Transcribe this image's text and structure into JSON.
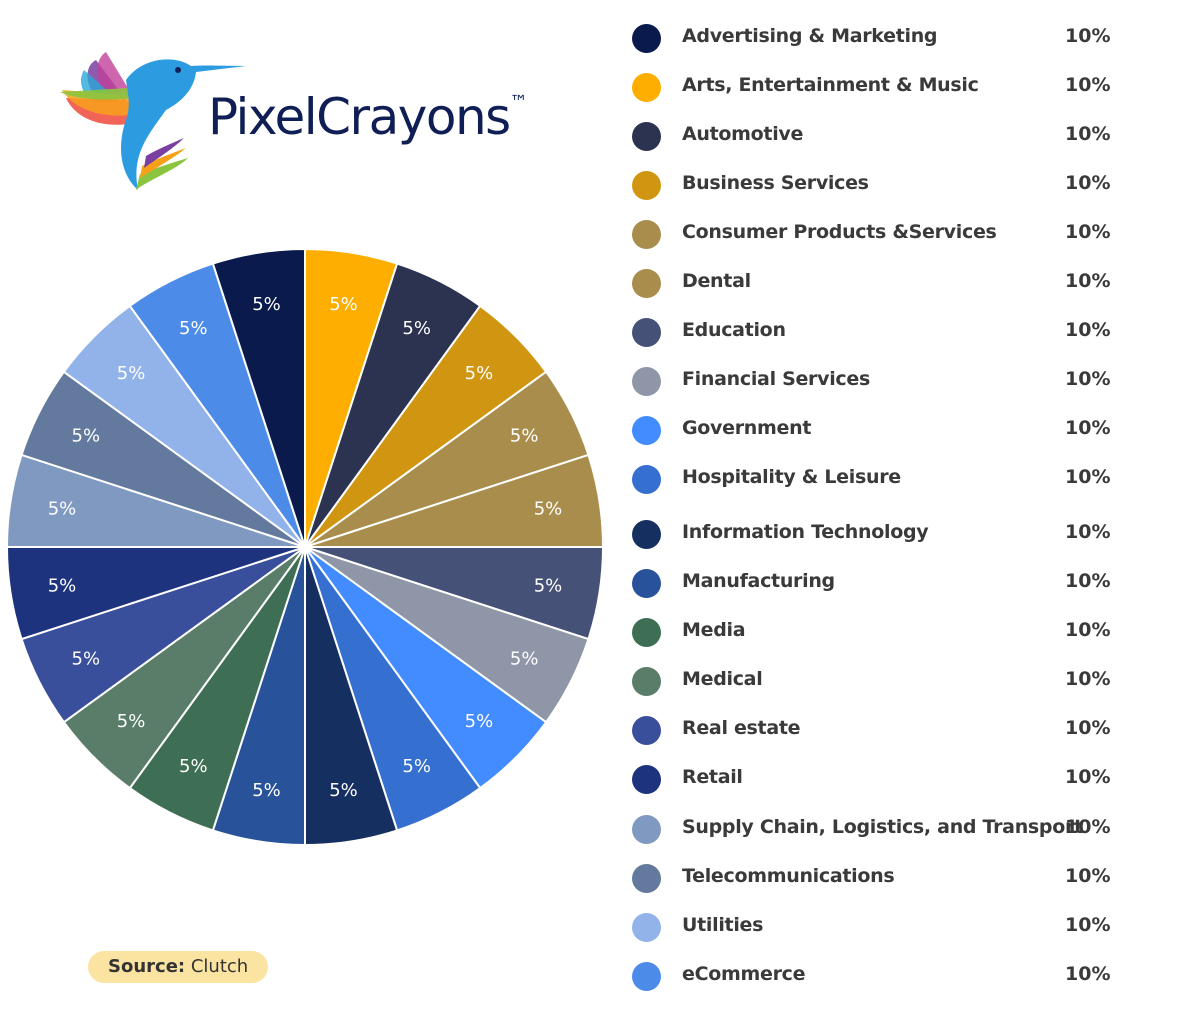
{
  "brand": {
    "name": "PixelCrayons",
    "tm": "™"
  },
  "source": {
    "label": "Source:",
    "value": "Clutch"
  },
  "chart_data": {
    "type": "pie",
    "start_angle_deg": -90,
    "categories": [
      "Advertising & Marketing",
      "Arts, Entertainment & Music",
      "Automotive",
      "Business Services",
      "Consumer Products &Services",
      "Dental",
      "Education",
      "Financial Services",
      "Government",
      "Hospitality & Leisure",
      "Information Technology",
      "Manufacturing",
      "Media",
      "Medical",
      "Real estate",
      "Retail",
      "Supply Chain, Logistics, and Transport",
      "Telecommunications",
      "Utilities",
      "eCommerce"
    ],
    "legend_values": [
      "10%",
      "10%",
      "10%",
      "10%",
      "10%",
      "10%",
      "10%",
      "10%",
      "10%",
      "10%",
      "10%",
      "10%",
      "10%",
      "10%",
      "10%",
      "10%",
      "10%",
      "10%",
      "10%",
      "10%"
    ],
    "slices": [
      {
        "category": "Arts, Entertainment & Music",
        "value": 5,
        "label": "5%",
        "color": "#FDAE00"
      },
      {
        "category": "Automotive",
        "value": 5,
        "label": "5%",
        "color": "#2C3350"
      },
      {
        "category": "Business Services",
        "value": 5,
        "label": "5%",
        "color": "#D09612"
      },
      {
        "category": "Consumer Products &Services",
        "value": 5,
        "label": "5%",
        "color": "#A98D4C"
      },
      {
        "category": "Dental",
        "value": 5,
        "label": "5%",
        "color": "#A98D4C"
      },
      {
        "category": "Education",
        "value": 5,
        "label": "5%",
        "color": "#465177"
      },
      {
        "category": "Financial Services",
        "value": 5,
        "label": "5%",
        "color": "#8F96A8"
      },
      {
        "category": "Government",
        "value": 5,
        "label": "5%",
        "color": "#428CFF"
      },
      {
        "category": "Hospitality & Leisure",
        "value": 5,
        "label": "5%",
        "color": "#3570D0"
      },
      {
        "category": "Information Technology",
        "value": 5,
        "label": "5%",
        "color": "#152F60"
      },
      {
        "category": "Manufacturing",
        "value": 5,
        "label": "5%",
        "color": "#28539B"
      },
      {
        "category": "Media",
        "value": 5,
        "label": "5%",
        "color": "#3E6F55"
      },
      {
        "category": "Medical",
        "value": 5,
        "label": "5%",
        "color": "#5A7D6A"
      },
      {
        "category": "Real estate",
        "value": 5,
        "label": "5%",
        "color": "#3A4F9C"
      },
      {
        "category": "Retail",
        "value": 5,
        "label": "5%",
        "color": "#1E337E"
      },
      {
        "category": "Supply Chain, Logistics, and Transport",
        "value": 5,
        "label": "5%",
        "color": "#8099C1"
      },
      {
        "category": "Telecommunications",
        "value": 5,
        "label": "5%",
        "color": "#637A9E"
      },
      {
        "category": "Utilities",
        "value": 5,
        "label": "5%",
        "color": "#92B2EA"
      },
      {
        "category": "eCommerce",
        "value": 5,
        "label": "5%",
        "color": "#4D8BE8"
      },
      {
        "category": "Advertising & Marketing",
        "value": 5,
        "label": "5%",
        "color": "#0A1A4D"
      }
    ],
    "legend_colors": [
      "#0A1A4D",
      "#FDAE00",
      "#2C3350",
      "#D09612",
      "#A98D4C",
      "#A98D4C",
      "#465177",
      "#8F96A8",
      "#428CFF",
      "#3570D0",
      "#152F60",
      "#28539B",
      "#3E6F55",
      "#5A7D6A",
      "#3A4F9C",
      "#1E337E",
      "#8099C1",
      "#637A9E",
      "#92B2EA",
      "#4D8BE8"
    ],
    "legend_placement": "right"
  }
}
